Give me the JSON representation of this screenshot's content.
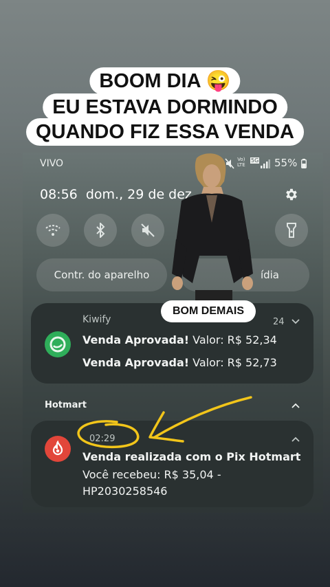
{
  "caption": {
    "line1": "BOOM DIA 😜",
    "line2": "EU ESTAVA DORMINDO",
    "line3": "QUANDO FIZ ESSA VENDA"
  },
  "status": {
    "carrier": "VIVO",
    "battery": "55%",
    "net_top": "Vo)",
    "net_bottom": "LTE",
    "badge": "5G"
  },
  "datetime": {
    "time": "08:56",
    "date": "dom., 29 de dez."
  },
  "quick_settings": {
    "icons": [
      "wifi-icon",
      "bluetooth-icon",
      "mute-icon",
      "flashlight-icon"
    ]
  },
  "pills": {
    "device_control": "Contr. do aparelho",
    "media": "ídia"
  },
  "sticker": {
    "label": "BOM DEMAIS"
  },
  "kiwify": {
    "app": "Kiwify",
    "count": "24",
    "rows": [
      {
        "title": "Venda Aprovada!",
        "value": "Valor: R$ 52,34"
      },
      {
        "title": "Venda Aprovada!",
        "value": "Valor: R$ 52,73"
      }
    ]
  },
  "hotmart": {
    "section": "Hotmart",
    "time": "02:29",
    "title": "Venda realizada com o Pix Hotmart",
    "line1": "Você recebeu: R$ 35,04 -",
    "line2": "HP2030258546"
  },
  "colors": {
    "kiwify_green": "#2fae5a",
    "hotmart_red": "#e2463a",
    "annotation_yellow": "#f2c51a"
  }
}
